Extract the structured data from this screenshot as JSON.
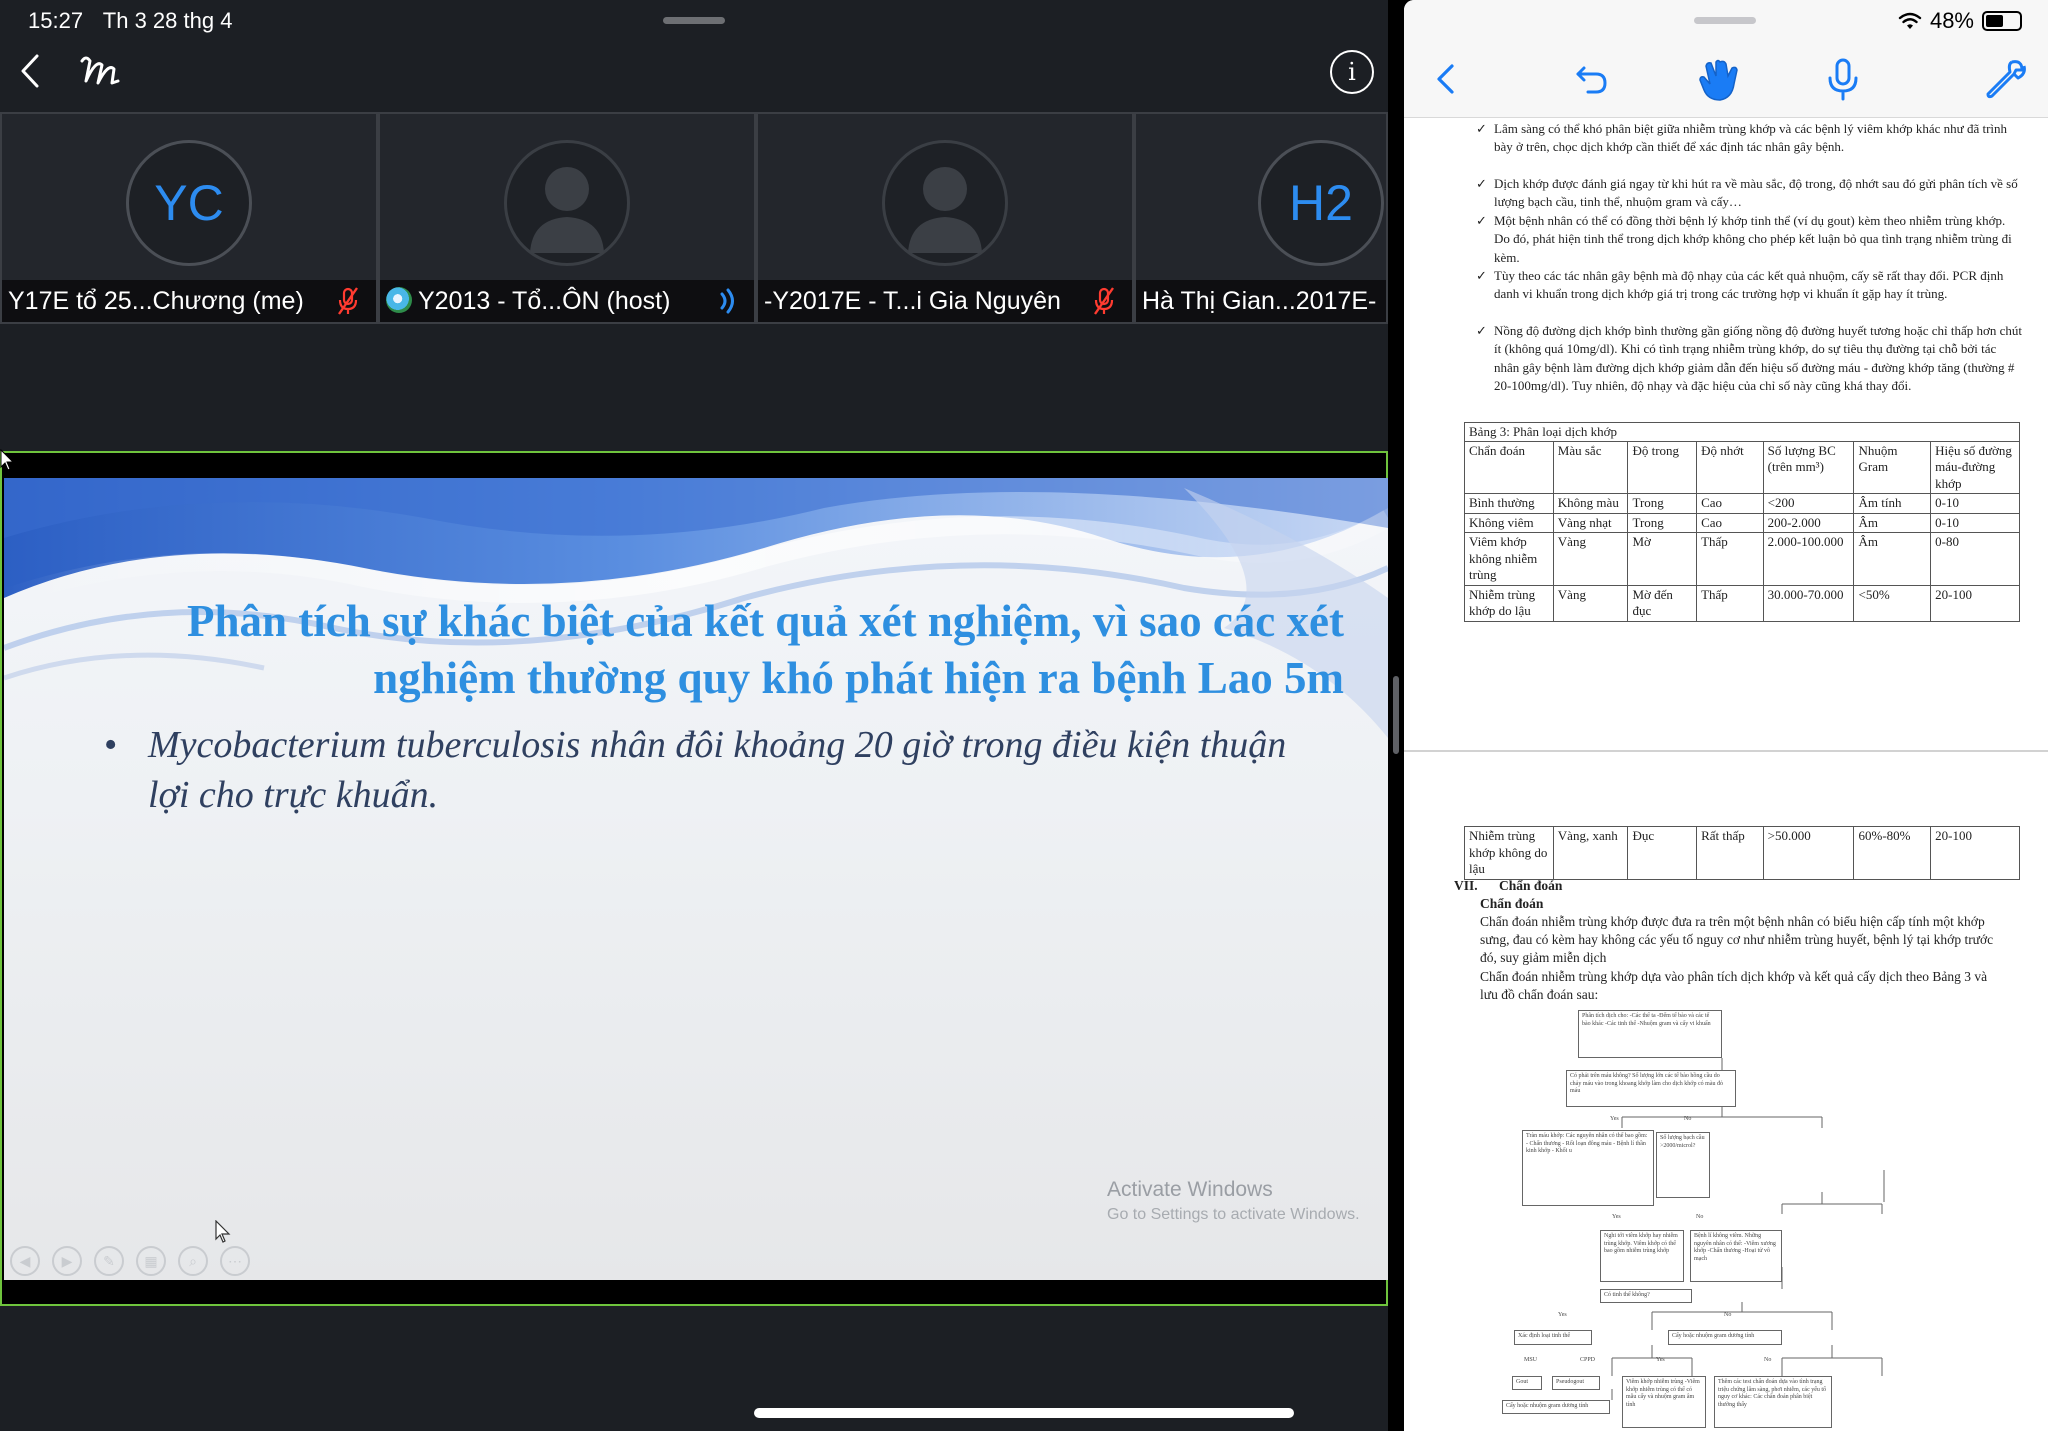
{
  "status": {
    "time": "15:27",
    "date": "Th 3 28 thg 4",
    "battery": "48%"
  },
  "meeting": {
    "participants": [
      {
        "initials": "YC",
        "name": "Y17E tổ 25...Chương (me)",
        "muted": true
      },
      {
        "initials": "",
        "name": "Y2013 - Tổ...ÔN (host)",
        "speaking": true
      },
      {
        "initials": "",
        "name": "-Y2017E - T...i Gia Nguyên",
        "muted": true
      },
      {
        "initials": "H2",
        "name": "Hà Thị Gian...2017E-"
      }
    ]
  },
  "slide": {
    "title": "Phân tích sự khác biệt của kết quả xét nghiệm, vì sao các xét nghiệm thường quy khó phát hiện ra bệnh Lao 5m",
    "bullet": "Mycobacterium tuberculosis nhân đôi khoảng 20 giờ trong điều kiện thuận lợi cho trực khuẩn.",
    "watermark_title": "Activate Windows",
    "watermark_sub": "Go to Settings to activate Windows."
  },
  "doc": {
    "bullets": [
      "Lâm sàng có thể khó phân biệt giữa nhiễm trùng khớp và các bệnh lý viêm khớp khác như đã trình bày ở trên, chọc dịch khớp cần thiết để xác định tác nhân gây bệnh.",
      "Dịch khớp được đánh giá ngay từ khi hút ra về màu sắc, độ trong, độ nhớt sau đó gửi phân tích về số lượng bạch cầu, tinh thể, nhuộm gram và cấy…",
      "Một bệnh nhân có thể có đồng thời bệnh lý khớp tinh thể (ví dụ gout) kèm theo nhiễm trùng khớp. Do đó, phát hiện tinh thể trong dịch khớp không cho phép kết luận bỏ qua tình trạng nhiễm trùng đi kèm.",
      "Tùy theo các tác nhân gây bệnh mà độ nhạy của các kết quả nhuộm, cấy sẽ rất thay đổi. PCR định danh vi khuẩn trong dịch khớp giá trị trong các trường hợp vi khuẩn ít gặp hay ít trùng.",
      "Nồng độ đường dịch khớp bình thường gần giống nồng độ đường huyết tương hoặc chỉ thấp hơn chút ít (không quá 10mg/dl). Khi có tình trạng nhiễm trùng khớp, do sự tiêu thụ đường tại chỗ bởi tác nhân gây bệnh làm đường dịch khớp giảm dẫn đến hiệu số đường máu - đường khớp tăng (thường # 20-100mg/dl). Tuy nhiên, độ nhạy và đặc hiệu của chỉ số này cũng khá thay đổi."
    ],
    "table_caption": "Bảng 3: Phân loại dịch khớp",
    "table_headers": [
      "Chẩn đoán",
      "Màu sắc",
      "Độ trong",
      "Độ nhớt",
      "Số lượng BC (trên mm³)",
      "Nhuộm Gram",
      "Hiệu số đường máu-đường khớp"
    ],
    "table_rows": [
      [
        "Bình thường",
        "Không màu",
        "Trong",
        "Cao",
        "<200",
        "Âm tính",
        "0-10"
      ],
      [
        "Không viêm",
        "Vàng nhạt",
        "Trong",
        "Cao",
        "200-2.000",
        "Âm",
        "0-10"
      ],
      [
        "Viêm khớp không nhiễm trùng",
        "Vàng",
        "Mờ",
        "Thấp",
        "2.000-100.000",
        "Âm",
        "0-80"
      ],
      [
        "Nhiễm trùng khớp do lậu",
        "Vàng",
        "Mờ đến đục",
        "Thấp",
        "30.000-70.000",
        "<50%",
        "20-100"
      ]
    ],
    "table2_row": [
      "Nhiễm trùng khớp không do lậu",
      "Vàng, xanh",
      "Đục",
      "Rất thấp",
      ">50.000",
      "60%-80%",
      "20-100"
    ],
    "section_num": "VII.",
    "section_title": "Chẩn đoán",
    "subsection": "Chẩn đoán",
    "para1": "Chẩn đoán nhiễm trùng khớp được đưa ra trên một bệnh nhân có biểu hiện cấp tính một khớp sưng, đau có kèm hay không các yếu tố nguy cơ như nhiễm trùng huyết, bệnh lý tại khớp trước đó, suy giảm miễn dịch",
    "para2": "Chẩn đoán nhiễm trùng khớp dựa vào phân tích dịch khớp và kết quả cấy dịch theo Bảng 3 và lưu đồ chẩn đoán sau:",
    "flow": {
      "b1": "Phân tích dịch cho: -Các thể ta -Đếm tế bào và các tế bào khác -Các tinh thể -Nhuộm gram và cấy vi khuẩn",
      "b2": "Có phải trên máu không? Số lượng lớn các tế bào hồng cầu do chảy máu vào trong khoang khớp làm cho dịch khớp có màu đỏ máu",
      "yes": "Yes",
      "no": "No",
      "b3": "Tràn máu khớp: Các nguyên nhân có thể bao gồm: - Chấn thương - Rối loạn đông máu - Bệnh lí thần kinh khớp - Khối u",
      "b4": "Số lượng bạch cầu >2000/microl?",
      "b5": "Nghi tới viêm khớp hay nhiễm trùng khớp. Viêm khớp có thể bao gồm nhiễm trùng khớp",
      "b6": "Bệnh lí không viêm. Những nguyên nhân có thể: -Viêm xương khớp -Chấn thương -Hoại tử vô mạch",
      "b7": "Có tinh thể không?",
      "b8": "Xác định loại tinh thể",
      "b9": "Cấy hoặc nhuộm gram dương tính",
      "msu": "MSU",
      "cppd": "CPPD",
      "b10": "Gout",
      "b11": "Pseudogout",
      "b12": "Cấy hoặc nhuộm gram dương tính",
      "b13": "Viêm khớp nhiễm trùng -Viêm khớp nhiễm trùng có thể có mẫu cấy và nhuộm gram âm tính",
      "b14": "Thêm các test chẩn đoán dựa vào tình trạng triệu chứng lâm sàng, phơi nhiễm, các yếu tố nguy cơ khác: Các chẩn đoán phân biệt thường thấy"
    }
  },
  "colors": {
    "accent": "#2d8cf0",
    "ios_blue": "#1a7cf5",
    "share_border": "#6fc43d",
    "slide_title": "#2e8fe0",
    "muted_red": "#ff3b30"
  }
}
